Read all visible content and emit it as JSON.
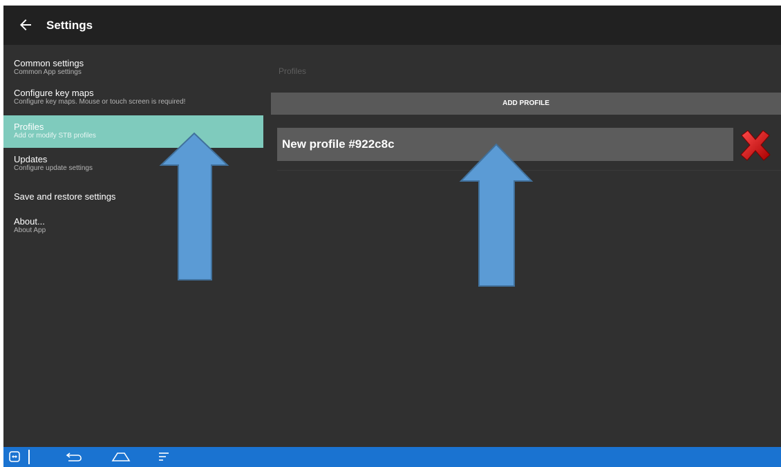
{
  "appbar": {
    "title": "Settings",
    "back_icon": "arrow-left-icon"
  },
  "sidebar": {
    "items": [
      {
        "title": "Common settings",
        "subtitle": "Common App settings",
        "selected": false
      },
      {
        "title": "Configure key maps",
        "subtitle": "Configure key maps. Mouse or touch screen is required!",
        "selected": false
      },
      {
        "title": "Profiles",
        "subtitle": "Add or modify STB profiles",
        "selected": true
      },
      {
        "title": "Updates",
        "subtitle": "Configure update settings",
        "selected": false
      },
      {
        "title": "Save and restore settings",
        "subtitle": "",
        "selected": false
      },
      {
        "title": "About...",
        "subtitle": "About App",
        "selected": false
      }
    ]
  },
  "content": {
    "section_label": "Profiles",
    "add_profile_label": "ADD PROFILE",
    "profiles": [
      {
        "name": "New profile #922c8c",
        "delete_icon": "red-x-delete-icon"
      }
    ]
  },
  "annotations": {
    "arrow_color": "#5b9bd5",
    "arrow_outline": "#41719c"
  },
  "navbar": {
    "color": "#1a73d1",
    "icons": [
      "teamviewer-icon",
      "back-icon",
      "home-icon",
      "menu-icon"
    ]
  }
}
